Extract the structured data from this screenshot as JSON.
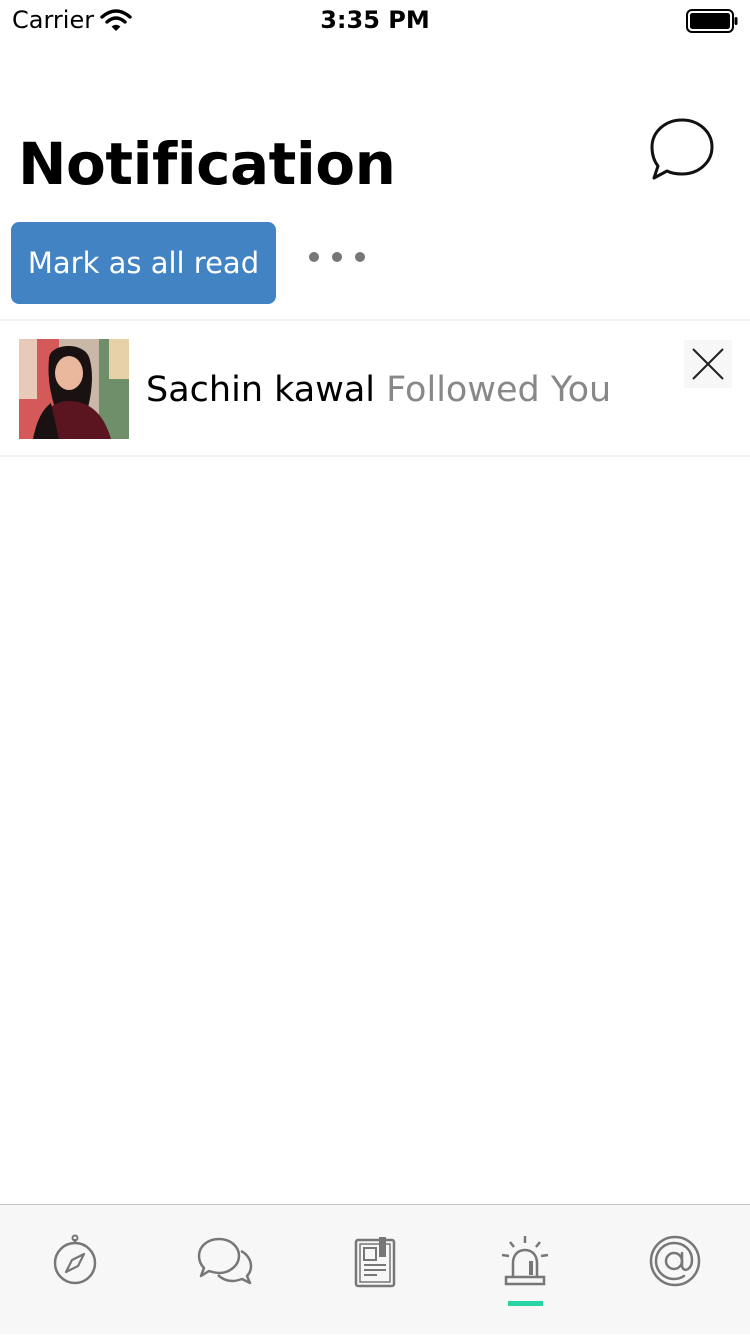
{
  "status_bar": {
    "carrier": "Carrier",
    "time": "3:35 PM"
  },
  "header": {
    "title": "Notification",
    "chat_icon": "chat-bubble-icon"
  },
  "actions": {
    "mark_all_read_label": "Mark as all read",
    "more_icon": "more-dots-icon"
  },
  "notifications": [
    {
      "name": "Sachin kawal",
      "action": "Followed You",
      "avatar": "user-photo",
      "dismiss_icon": "close-icon"
    }
  ],
  "tab_bar": {
    "tabs": [
      {
        "icon": "compass-icon",
        "active": false
      },
      {
        "icon": "chat-bubbles-icon",
        "active": false
      },
      {
        "icon": "news-icon",
        "active": false
      },
      {
        "icon": "alarm-siren-icon",
        "active": true
      },
      {
        "icon": "at-sign-icon",
        "active": false
      }
    ],
    "active_color": "#2ad3a3"
  },
  "colors": {
    "accent": "#4283c4",
    "secondary_text": "#888888"
  }
}
